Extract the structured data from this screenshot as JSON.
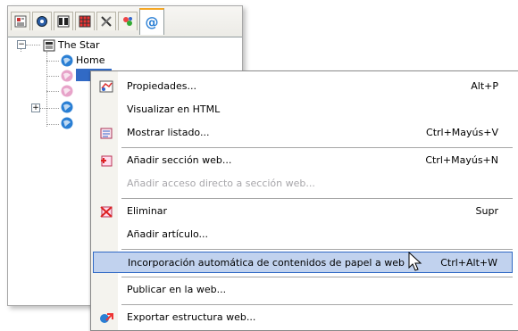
{
  "tree": {
    "tabs": [
      {
        "name": "tab-newspaper",
        "icon": "newspaper-icon"
      },
      {
        "name": "tab-gear",
        "icon": "gear-icon"
      },
      {
        "name": "tab-columns",
        "icon": "columns-icon"
      },
      {
        "name": "tab-grid",
        "icon": "grid-icon"
      },
      {
        "name": "tab-tools",
        "icon": "tools-icon"
      },
      {
        "name": "tab-paint",
        "icon": "paint-icon"
      },
      {
        "name": "tab-web",
        "icon": "at-icon",
        "label": "@",
        "active": true
      }
    ],
    "root_label": "The Star",
    "home_label": "Home",
    "colors": {
      "selected_bg": "#316ac5",
      "globe_blue": "#2a7fd4",
      "globe_pink": "#e7a3c9"
    }
  },
  "menu": {
    "items": [
      {
        "name": "menu-item-propiedades",
        "label": "Propiedades...",
        "shortcut": "Alt+P",
        "icon": "properties-icon"
      },
      {
        "name": "menu-item-visualizar-html",
        "label": "Visualizar en HTML",
        "shortcut": ""
      },
      {
        "name": "menu-item-mostrar-listado",
        "label": "Mostrar listado...",
        "shortcut": "Ctrl+Mayús+V",
        "icon": "list-icon"
      },
      {
        "name": "menu-item-anadir-seccion-web",
        "label": "Añadir sección web...",
        "shortcut": "Ctrl+Mayús+N",
        "icon": "add-section-icon"
      },
      {
        "name": "menu-item-anadir-acceso-directo",
        "label": "Añadir acceso directo a sección web...",
        "shortcut": "",
        "disabled": true
      },
      {
        "name": "menu-item-eliminar",
        "label": "Eliminar",
        "shortcut": "Supr",
        "icon": "delete-icon"
      },
      {
        "name": "menu-item-anadir-articulo",
        "label": "Añadir artículo...",
        "shortcut": ""
      },
      {
        "name": "menu-item-incorporacion-automatica",
        "label": "Incorporación automática de contenidos de papel a web",
        "shortcut": "Ctrl+Alt+W",
        "highlighted": true
      },
      {
        "name": "menu-item-publicar-web",
        "label": "Publicar en la web...",
        "shortcut": ""
      },
      {
        "name": "menu-item-exportar-estructura",
        "label": "Exportar estructura web...",
        "shortcut": "",
        "icon": "export-icon"
      }
    ],
    "colors": {
      "highlight_bg": "#c1d2ee",
      "highlight_border": "#316ac5",
      "disabled_text": "#a7a6aa"
    }
  }
}
